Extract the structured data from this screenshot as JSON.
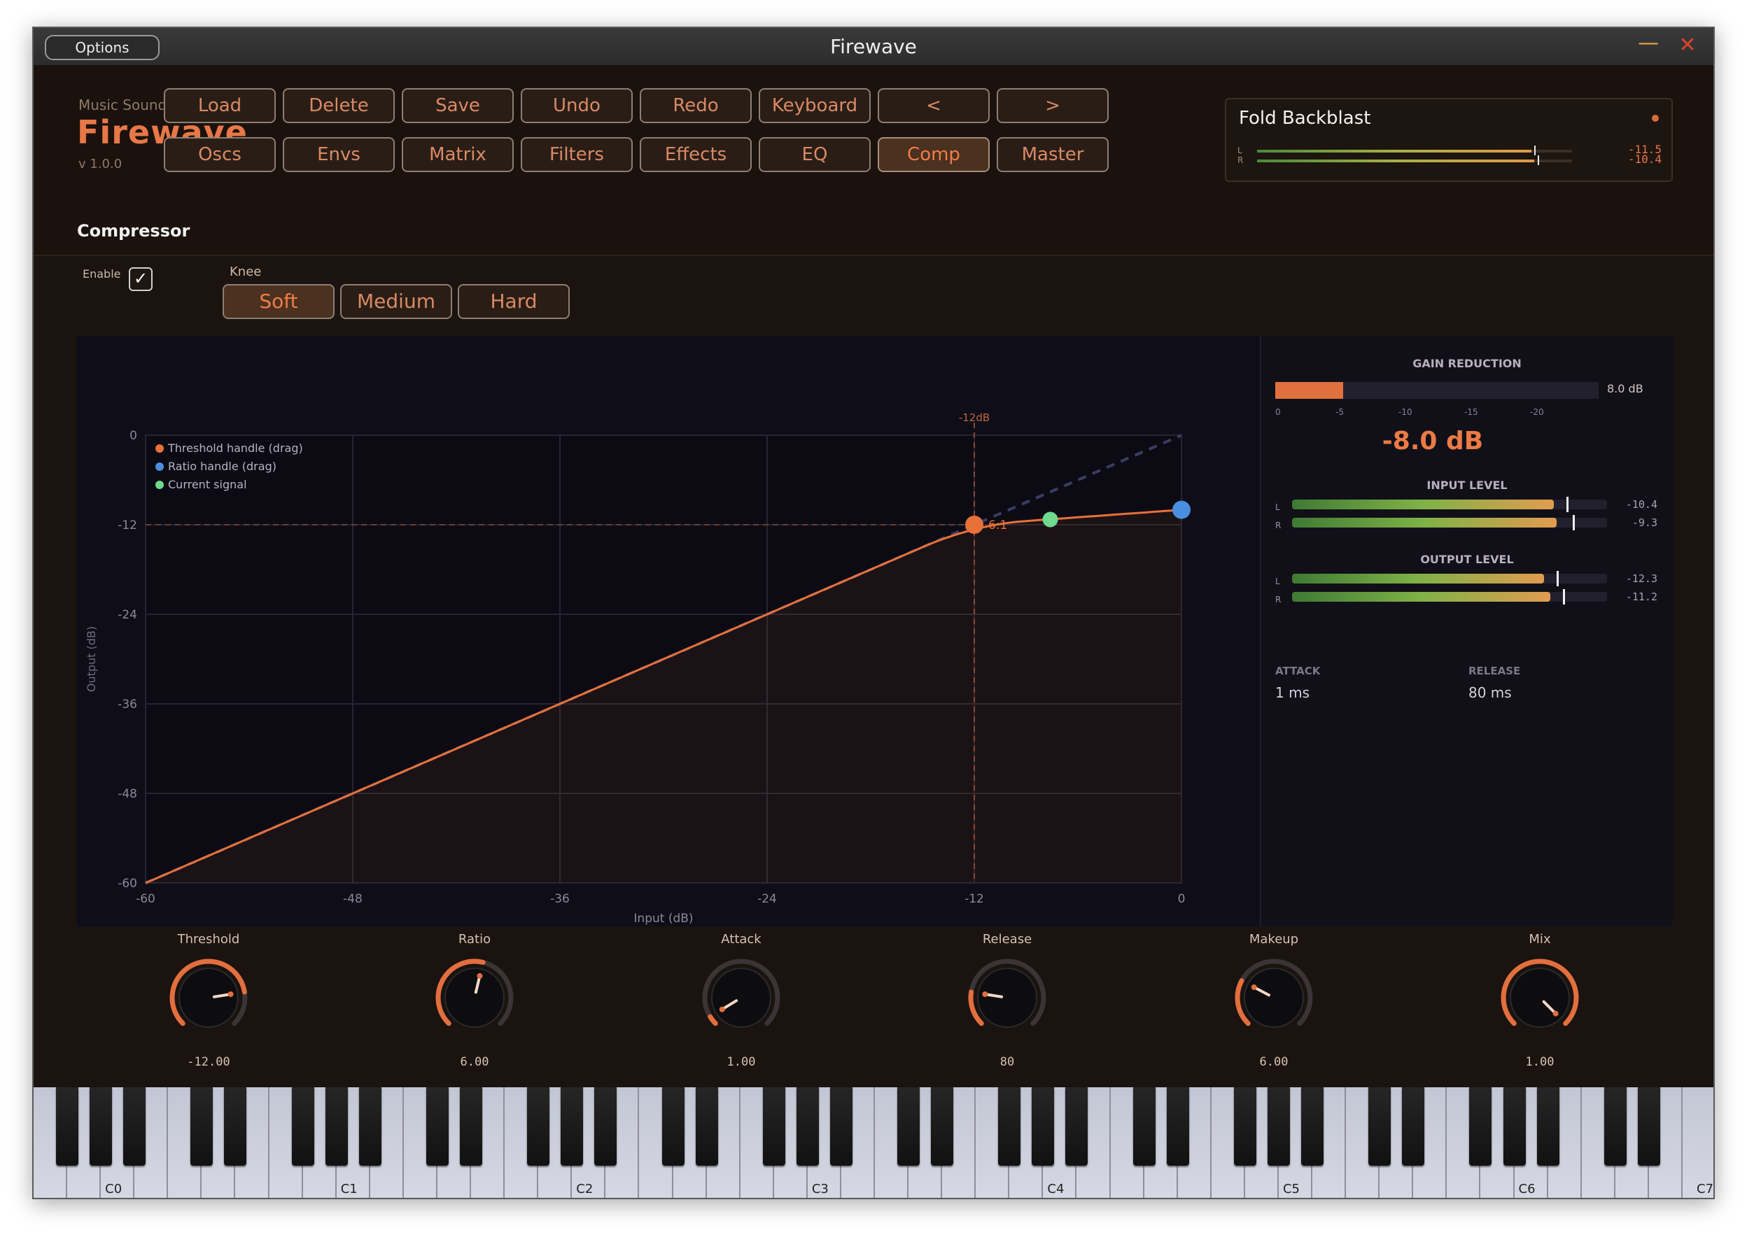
{
  "window": {
    "title": "Firewave",
    "options_label": "Options",
    "minimize_glyph": "—",
    "close_glyph": "✕"
  },
  "brand": {
    "company": "Music Sound Software",
    "name": "Firewave",
    "version": "v 1.0.0"
  },
  "nav": {
    "row1": [
      "Load",
      "Delete",
      "Save",
      "Undo",
      "Redo",
      "Keyboard",
      "<",
      ">"
    ],
    "row2": [
      "Oscs",
      "Envs",
      "Matrix",
      "Filters",
      "Effects",
      "EQ",
      "Comp",
      "Master"
    ],
    "active": "Comp"
  },
  "preset": {
    "name": "Fold Backblast",
    "meters": [
      {
        "label": "L",
        "level": 0.87,
        "peak": 0.88,
        "value": "-11.5"
      },
      {
        "label": "R",
        "level": 0.88,
        "peak": 0.89,
        "value": "-10.4"
      }
    ]
  },
  "section": {
    "title": "Compressor"
  },
  "controls": {
    "enable_label": "Enable",
    "enable_checked": true,
    "knee_label": "Knee",
    "knee_options": [
      "Soft",
      "Medium",
      "Hard"
    ],
    "knee_selected": "Soft"
  },
  "chart_data": {
    "type": "line",
    "x_label": "Input (dB)",
    "y_label": "Output (dB)",
    "xlim": [
      -60,
      0
    ],
    "ylim": [
      -60,
      0
    ],
    "x_ticks": [
      -60,
      -48,
      -36,
      -24,
      -12,
      0
    ],
    "y_ticks": [
      0,
      -12,
      -24,
      -36,
      -48,
      -60
    ],
    "grid": true,
    "legend_position": "top-left",
    "legend": [
      {
        "label": "Threshold handle (drag)",
        "color": "#e8713a"
      },
      {
        "label": "Ratio handle (drag)",
        "color": "#4a8ee0"
      },
      {
        "label": "Current signal",
        "color": "#6fd98e"
      }
    ],
    "threshold": -12,
    "threshold_label": "-12dB",
    "ratio_label": "6:1",
    "ratio": 6,
    "knee_width": 6,
    "threshold_point": {
      "x": -12,
      "y": -12
    },
    "ratio_point": {
      "x": 0,
      "y": -10
    },
    "signal_point": {
      "x": -7.6,
      "y": -11.3
    },
    "colors": {
      "curve": "#e8713a",
      "grid": "#252432",
      "unity": "#3c3c62",
      "plot_bg": "#0c0b14"
    }
  },
  "meters": {
    "gain_reduction": {
      "title": "GAIN REDUCTION",
      "amount": 0.21,
      "value": "8.0 dB",
      "ticks": [
        "0",
        "-5",
        "-10",
        "-15",
        "-20"
      ],
      "big_value": "-8.0 dB"
    },
    "input_level": {
      "title": "INPUT LEVEL",
      "channels": [
        {
          "label": "L",
          "level": 0.83,
          "peak": 0.87,
          "value": "-10.4"
        },
        {
          "label": "R",
          "level": 0.84,
          "peak": 0.89,
          "value": "-9.3"
        }
      ]
    },
    "output_level": {
      "title": "OUTPUT LEVEL",
      "channels": [
        {
          "label": "L",
          "level": 0.8,
          "peak": 0.84,
          "value": "-12.3"
        },
        {
          "label": "R",
          "level": 0.82,
          "peak": 0.86,
          "value": "-11.2"
        }
      ]
    },
    "attack": {
      "title": "ATTACK",
      "value": "1 ms"
    },
    "release": {
      "title": "RELEASE",
      "value": "80 ms"
    }
  },
  "knobs": [
    {
      "name": "Threshold",
      "value": "-12.00",
      "amount": 0.8
    },
    {
      "name": "Ratio",
      "value": "6.00",
      "amount": 0.55
    },
    {
      "name": "Attack",
      "value": "1.00",
      "amount": 0.05
    },
    {
      "name": "Release",
      "value": "80",
      "amount": 0.2
    },
    {
      "name": "Makeup",
      "value": "6.00",
      "amount": 0.27
    },
    {
      "name": "Mix",
      "value": "1.00",
      "amount": 1.0
    }
  ],
  "keyboard": {
    "octave_labels": [
      "C0",
      "C1",
      "C2",
      "C3",
      "C4",
      "C5",
      "C6",
      "C7"
    ]
  },
  "icons": {
    "check": "check-icon",
    "minimize": "minimize-icon",
    "close": "close-icon",
    "preset_dot": "status-dot-icon"
  }
}
